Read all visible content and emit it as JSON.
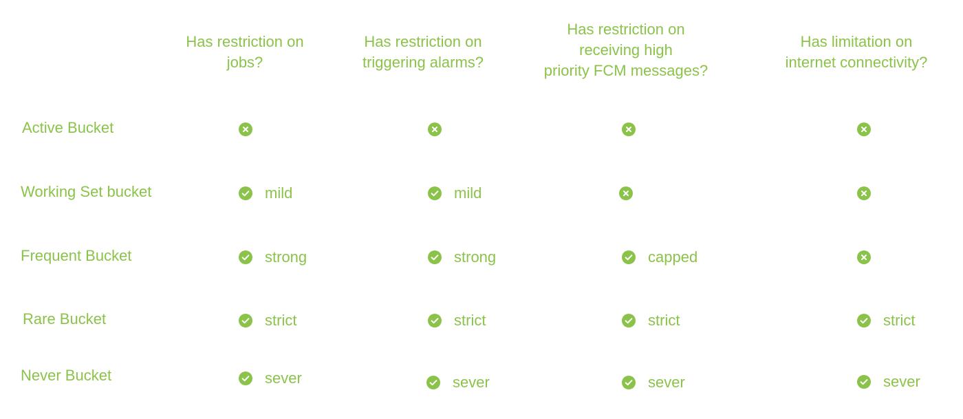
{
  "colors": {
    "accent": "#8bc34a",
    "background": "#ffffff"
  },
  "headers": [
    "Has restriction on\njobs?",
    "Has restriction on\ntriggering alarms?",
    "Has restriction on\nreceiving high\npriority FCM messages?",
    "Has limitation on\ninternet connectivity?"
  ],
  "rows": [
    {
      "label": "Active Bucket",
      "cells": [
        {
          "icon": "x-circle-icon",
          "level": ""
        },
        {
          "icon": "x-circle-icon",
          "level": ""
        },
        {
          "icon": "x-circle-icon",
          "level": ""
        },
        {
          "icon": "x-circle-icon",
          "level": ""
        }
      ]
    },
    {
      "label": "Working Set bucket",
      "cells": [
        {
          "icon": "check-circle-icon",
          "level": "mild"
        },
        {
          "icon": "check-circle-icon",
          "level": "mild"
        },
        {
          "icon": "x-circle-icon",
          "level": ""
        },
        {
          "icon": "x-circle-icon",
          "level": ""
        }
      ]
    },
    {
      "label": "Frequent Bucket",
      "cells": [
        {
          "icon": "check-circle-icon",
          "level": "strong"
        },
        {
          "icon": "check-circle-icon",
          "level": "strong"
        },
        {
          "icon": "check-circle-icon",
          "level": "capped"
        },
        {
          "icon": "x-circle-icon",
          "level": ""
        }
      ]
    },
    {
      "label": "Rare Bucket",
      "cells": [
        {
          "icon": "check-circle-icon",
          "level": "strict"
        },
        {
          "icon": "check-circle-icon",
          "level": "strict"
        },
        {
          "icon": "check-circle-icon",
          "level": "strict"
        },
        {
          "icon": "check-circle-icon",
          "level": "strict"
        }
      ]
    },
    {
      "label": "Never Bucket",
      "cells": [
        {
          "icon": "check-circle-icon",
          "level": "sever"
        },
        {
          "icon": "check-circle-icon",
          "level": "sever"
        },
        {
          "icon": "check-circle-icon",
          "level": "sever"
        },
        {
          "icon": "check-circle-icon",
          "level": "sever"
        }
      ]
    }
  ]
}
